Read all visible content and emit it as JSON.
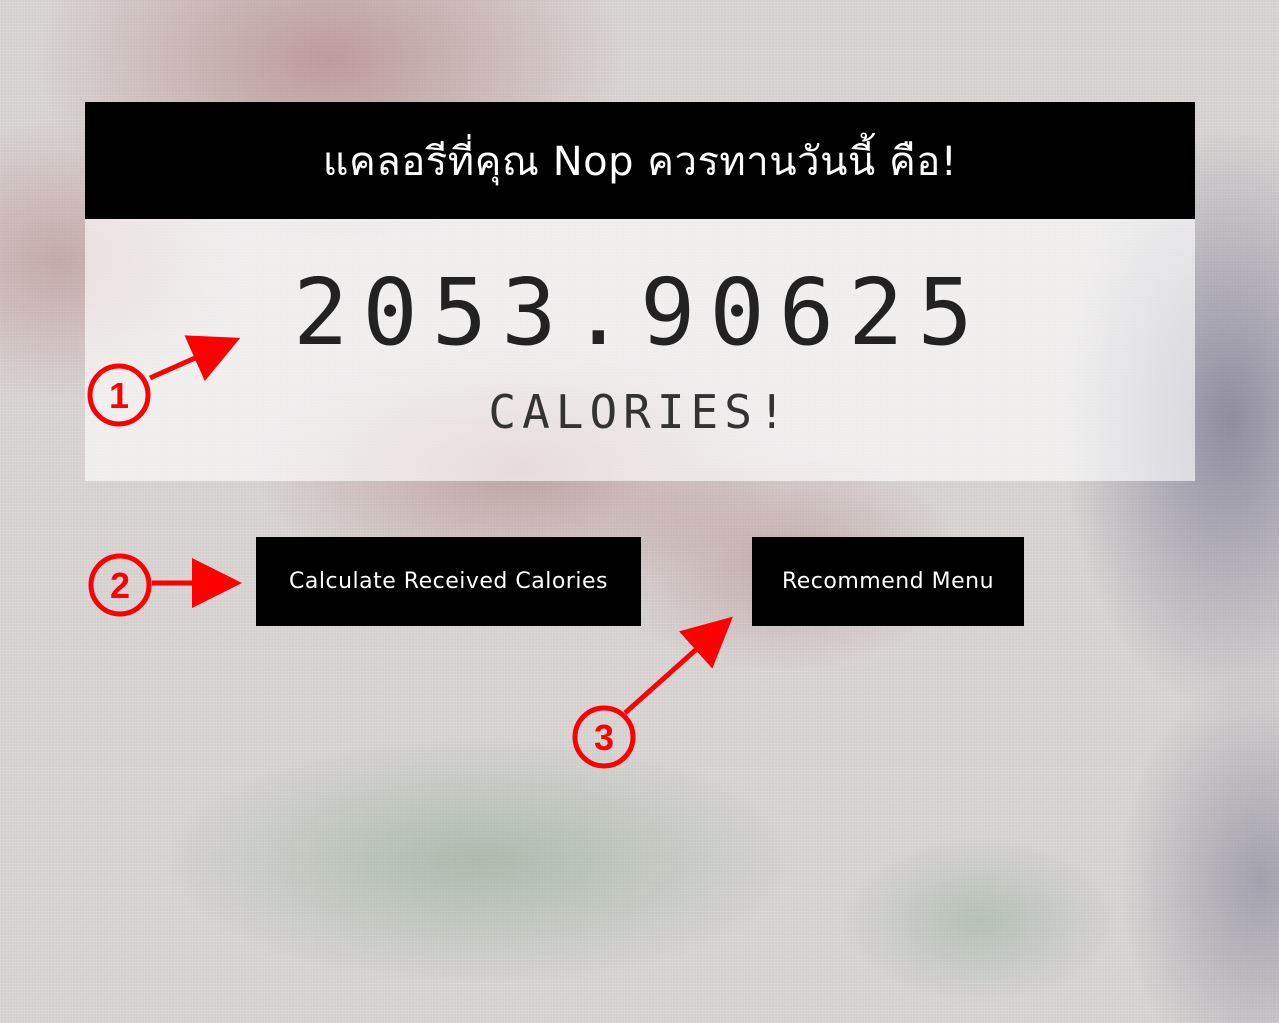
{
  "header": {
    "title": "แคลอรีที่คุณ Nop ควรทานวันนี้ คือ!"
  },
  "result": {
    "value": "2053.90625",
    "unit": "CALORIES!"
  },
  "actions": {
    "calculate_label": "Calculate Received Calories",
    "recommend_label": "Recommend Menu"
  },
  "annotations": {
    "color": "#ff0000",
    "markers": [
      "1",
      "2",
      "3"
    ]
  },
  "colors": {
    "header_bg": "#000000",
    "header_text": "#ffffff",
    "button_bg": "#000000",
    "button_text": "#ffffff"
  }
}
